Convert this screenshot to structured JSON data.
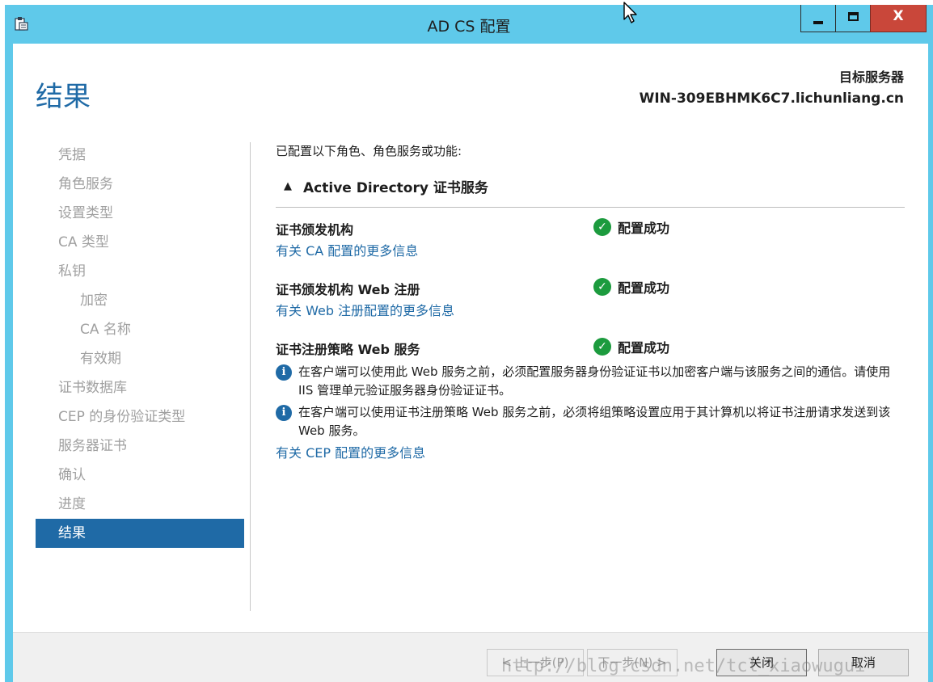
{
  "window": {
    "title": "AD CS 配置",
    "controls": {
      "minimize": "minimize",
      "maximize": "maximize",
      "close": "X"
    }
  },
  "header": {
    "page_title": "结果",
    "server_label": "目标服务器",
    "server_name": "WIN-309EBHMK6C7.lichunliang.cn"
  },
  "sidebar": {
    "items": [
      {
        "label": "凭据",
        "indent": false,
        "active": false
      },
      {
        "label": "角色服务",
        "indent": false,
        "active": false
      },
      {
        "label": "设置类型",
        "indent": false,
        "active": false
      },
      {
        "label": "CA 类型",
        "indent": false,
        "active": false
      },
      {
        "label": "私钥",
        "indent": false,
        "active": false
      },
      {
        "label": "加密",
        "indent": true,
        "active": false
      },
      {
        "label": "CA 名称",
        "indent": true,
        "active": false
      },
      {
        "label": "有效期",
        "indent": true,
        "active": false
      },
      {
        "label": "证书数据库",
        "indent": false,
        "active": false
      },
      {
        "label": "CEP 的身份验证类型",
        "indent": false,
        "active": false
      },
      {
        "label": "服务器证书",
        "indent": false,
        "active": false
      },
      {
        "label": "确认",
        "indent": false,
        "active": false
      },
      {
        "label": "进度",
        "indent": false,
        "active": false
      },
      {
        "label": "结果",
        "indent": false,
        "active": true
      }
    ]
  },
  "main": {
    "intro": "已配置以下角色、角色服务或功能:",
    "section_title": "Active Directory 证书服务",
    "features": [
      {
        "name": "证书颁发机构",
        "status": "配置成功",
        "link": "有关 CA 配置的更多信息"
      },
      {
        "name": "证书颁发机构 Web 注册",
        "status": "配置成功",
        "link": "有关 Web 注册配置的更多信息"
      },
      {
        "name": "证书注册策略 Web 服务",
        "status": "配置成功"
      }
    ],
    "notes": [
      "在客户端可以使用此 Web 服务之前，必须配置服务器身份验证证书以加密客户端与该服务之间的通信。请使用 IIS 管理单元验证服务器身份验证证书。",
      "在客户端可以使用证书注册策略 Web 服务之前，必须将组策略设置应用于其计算机以将证书注册请求发送到该 Web 服务。"
    ],
    "cep_link": "有关 CEP 配置的更多信息"
  },
  "footer": {
    "prev": "< 上一步(P)",
    "next": "下一步(N) >",
    "close": "关闭",
    "cancel": "取消"
  },
  "watermark": "http://blog.csdn.net/tcl_xiaowugui",
  "colors": {
    "titlebar": "#5fc9ea",
    "accent": "#1f6aa6",
    "success": "#1c9b3e",
    "close_button": "#c9473a"
  }
}
